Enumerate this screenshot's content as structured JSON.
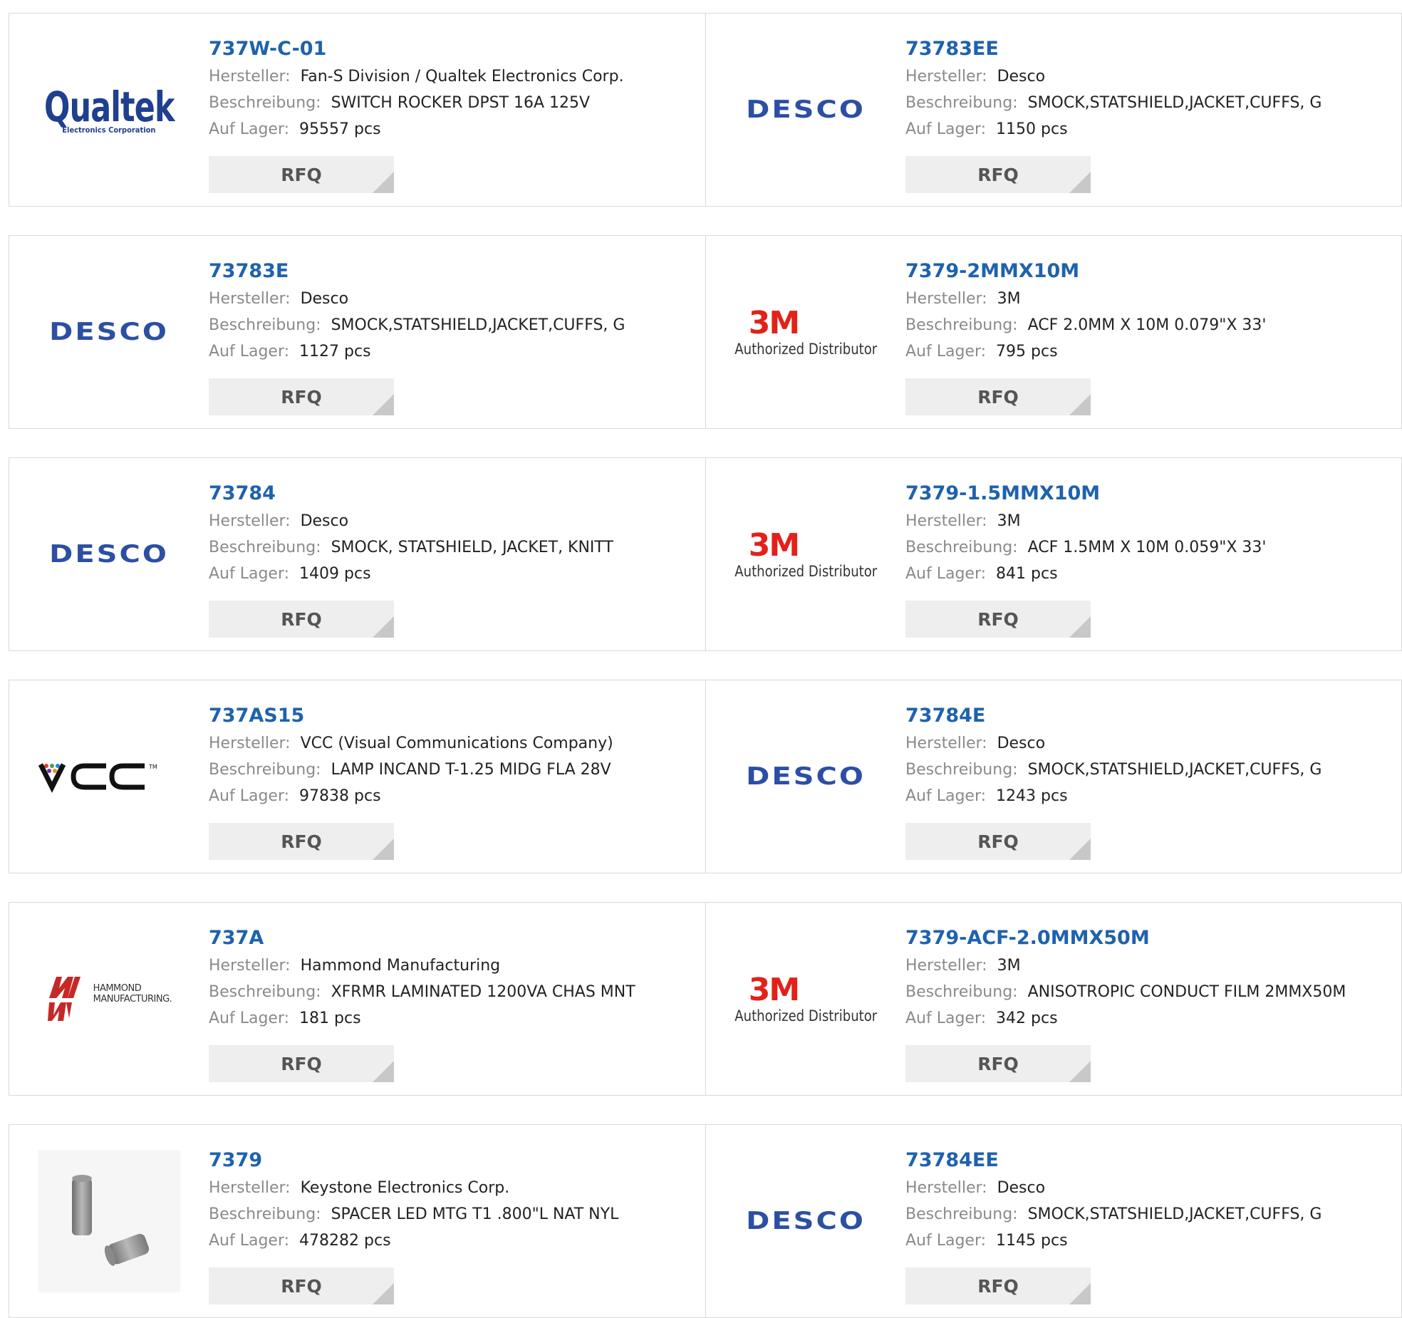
{
  "labels": {
    "manufacturer": "Hersteller:",
    "description": "Beschreibung:",
    "stock": "Auf Lager:",
    "rfq": "RFQ"
  },
  "logo_texts": {
    "desco": "DESCO",
    "qualtek_main": "Qualtek",
    "qualtek_sub": "Electronics Corporation",
    "threem_main": "3M",
    "threem_sub": "Authorized Distributor",
    "hammond_line1": "HAMMOND",
    "hammond_line2": "MANUFACTURING."
  },
  "rows": [
    [
      {
        "part": "737W-C-01",
        "logo": "qualtek",
        "manufacturer": "Fan-S Division / Qualtek Electronics Corp.",
        "description": "SWITCH ROCKER DPST 16A 125V",
        "stock": "95557 pcs"
      },
      {
        "part": "73783EE",
        "logo": "desco",
        "manufacturer": "Desco",
        "description": "SMOCK,STATSHIELD,JACKET,CUFFS, G",
        "stock": "1150 pcs"
      }
    ],
    [
      {
        "part": "73783E",
        "logo": "desco",
        "manufacturer": "Desco",
        "description": "SMOCK,STATSHIELD,JACKET,CUFFS, G",
        "stock": "1127 pcs"
      },
      {
        "part": "7379-2MMX10M",
        "logo": "3m",
        "manufacturer": "3M",
        "description": "ACF 2.0MM X 10M 0.079\"X 33'",
        "stock": "795 pcs"
      }
    ],
    [
      {
        "part": "73784",
        "logo": "desco",
        "manufacturer": "Desco",
        "description": "SMOCK, STATSHIELD, JACKET, KNITT",
        "stock": "1409 pcs"
      },
      {
        "part": "7379-1.5MMX10M",
        "logo": "3m",
        "manufacturer": "3M",
        "description": "ACF 1.5MM X 10M 0.059\"X 33'",
        "stock": "841 pcs"
      }
    ],
    [
      {
        "part": "737AS15",
        "logo": "vcc",
        "manufacturer": "VCC (Visual Communications Company)",
        "description": "LAMP INCAND T-1.25 MIDG FLA 28V",
        "stock": "97838 pcs"
      },
      {
        "part": "73784E",
        "logo": "desco",
        "manufacturer": "Desco",
        "description": "SMOCK,STATSHIELD,JACKET,CUFFS, G",
        "stock": "1243 pcs"
      }
    ],
    [
      {
        "part": "737A",
        "logo": "hammond",
        "manufacturer": "Hammond Manufacturing",
        "description": "XFRMR LAMINATED 1200VA CHAS MNT",
        "stock": "181 pcs"
      },
      {
        "part": "7379-ACF-2.0MMX50M",
        "logo": "3m",
        "manufacturer": "3M",
        "description": "ANISOTROPIC CONDUCT FILM 2MMX50M",
        "stock": "342 pcs"
      }
    ],
    [
      {
        "part": "7379",
        "logo": "photo",
        "manufacturer": "Keystone Electronics Corp.",
        "description": "SPACER LED MTG T1 .800\"L NAT NYL",
        "stock": "478282 pcs"
      },
      {
        "part": "73784EE",
        "logo": "desco",
        "manufacturer": "Desco",
        "description": "SMOCK,STATSHIELD,JACKET,CUFFS, G",
        "stock": "1145 pcs"
      }
    ]
  ],
  "colors": {
    "part_link": "#1f62ad",
    "label_gray": "#8a8a8a",
    "desco_blue": "#2c4fa3",
    "threem_red": "#e32119",
    "border": "#d9d9d9"
  }
}
